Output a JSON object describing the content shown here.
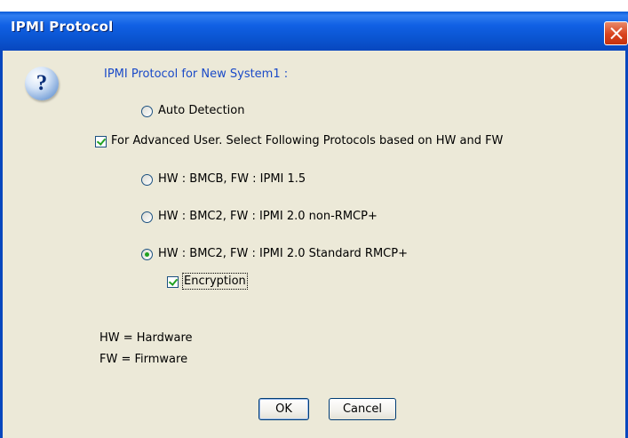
{
  "window": {
    "title": "IPMI Protocol"
  },
  "dialog": {
    "heading": "IPMI Protocol for New System1 :",
    "options": {
      "auto_detection": {
        "label": "Auto Detection",
        "checked": false
      },
      "advanced_user": {
        "label": "For Advanced User. Select Following Protocols based on HW and FW",
        "checked": true
      },
      "proto_bmcb": {
        "label": "HW : BMCB,  FW : IPMI 1.5",
        "checked": false
      },
      "proto_bmc2_nonrmcp": {
        "label": "HW : BMC2,  FW : IPMI 2.0 non-RMCP+",
        "checked": false
      },
      "proto_bmc2_rmcp": {
        "label": "HW : BMC2,  FW : IPMI 2.0 Standard RMCP+",
        "checked": true
      },
      "encryption": {
        "label": "Encryption",
        "checked": true
      }
    },
    "legend": {
      "hw": "HW = Hardware",
      "fw": "FW = Firmware"
    },
    "buttons": {
      "ok": "OK",
      "cancel": "Cancel"
    }
  },
  "icons": {
    "help": "question-icon",
    "close": "close-icon"
  },
  "colors": {
    "titlebar": "#0A54D0",
    "heading_text": "#1A4AC8",
    "face": "#ECE9D8",
    "check_mark": "#21A121"
  }
}
